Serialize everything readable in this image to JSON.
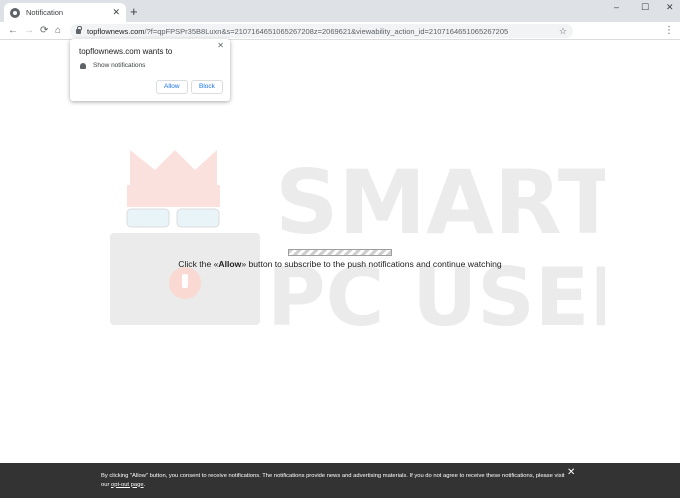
{
  "browser": {
    "tab_title": "Notification",
    "tab_close": "✕",
    "new_tab": "+",
    "window_controls": {
      "minimize": "–",
      "maximize": "☐",
      "close": "✕"
    },
    "nav": {
      "back": "←",
      "forward": "→",
      "reload": "⟳",
      "home": "⌂"
    },
    "url_domain": "topflownews.com",
    "url_rest": "/?f=qpFPSPr35B8Luxn&s=2107164651065267208z=2069621&viewability_action_id=2107164651065267205",
    "star": "☆",
    "menu": "⋮"
  },
  "prompt": {
    "title": "topflownews.com wants to",
    "close": "✕",
    "permission": "Show notifications",
    "allow_label": "Allow",
    "block_label": "Block"
  },
  "watermark": {
    "line1": "SMART",
    "line2": "PC USER"
  },
  "page": {
    "message_before": "Click the «",
    "message_bold": "Allow",
    "message_after": "» button to subscribe to the push notifications and continue watching"
  },
  "consent": {
    "text": "By clicking \"Allow\" button, you consent to receive notifications. The notifications provide news and advertising materials. If you do not agree to receive these notifications, please visit our ",
    "link": "opt-out page",
    "end": ".",
    "close": "✕"
  },
  "colors": {
    "tabstrip": "#dee1e6",
    "omnibox": "#f1f3f4",
    "button_text": "#1a73e8",
    "consent_bg": "#333333",
    "watermark": "#ebebeb",
    "crown": "#fbe1dd"
  }
}
